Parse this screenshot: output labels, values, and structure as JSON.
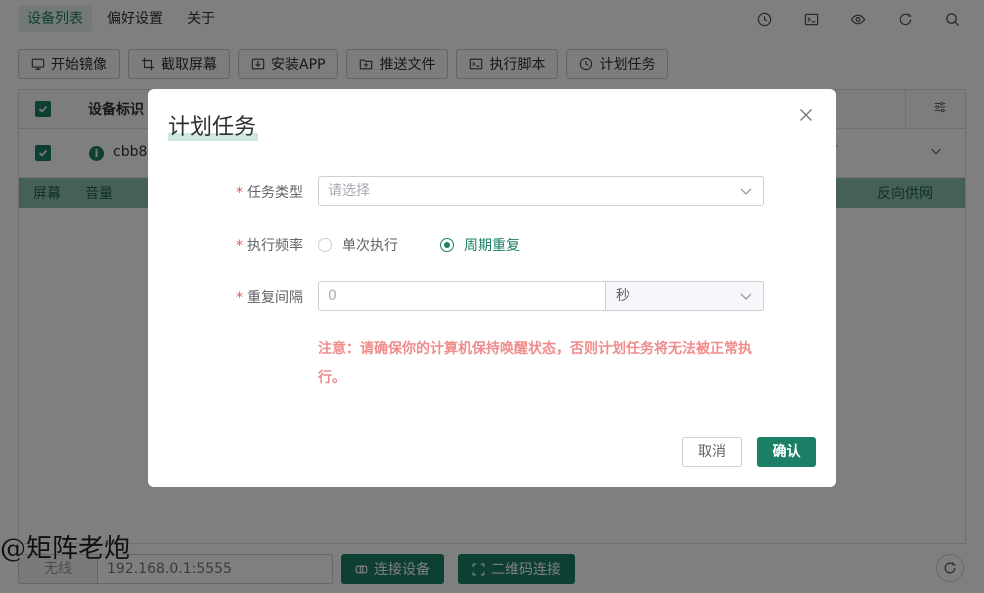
{
  "topnav": {
    "items": [
      {
        "label": "设备列表",
        "active": true
      },
      {
        "label": "偏好设置",
        "active": false
      },
      {
        "label": "关于",
        "active": false
      }
    ]
  },
  "topIcons": [
    "history-icon",
    "terminal-icon",
    "eye-icon",
    "refresh-icon",
    "search-icon"
  ],
  "toolbar": {
    "buttons": [
      {
        "label": "开始镜像",
        "icon": "monitor-icon"
      },
      {
        "label": "截取屏幕",
        "icon": "crop-icon"
      },
      {
        "label": "安装APP",
        "icon": "install-icon"
      },
      {
        "label": "推送文件",
        "icon": "folder-upload-icon"
      },
      {
        "label": "执行脚本",
        "icon": "terminal-icon"
      },
      {
        "label": "计划任务",
        "icon": "clock-icon"
      }
    ]
  },
  "table": {
    "header_label": "设备标识",
    "row_id": "cbb8",
    "greenbar_left": [
      "屏幕",
      "音量"
    ],
    "greenbar_right": "反向供网"
  },
  "footer": {
    "wire_label": "无线",
    "ip_value": "192.168.0.1:5555",
    "connect_label": "连接设备",
    "qr_label": "二维码连接"
  },
  "watermark": "@矩阵老炮",
  "dialog": {
    "title": "计划任务",
    "task_type_label": "任务类型",
    "task_type_placeholder": "请选择",
    "frequency_label": "执行频率",
    "frequency_options": [
      {
        "label": "单次执行",
        "checked": false
      },
      {
        "label": "周期重复",
        "checked": true
      }
    ],
    "interval_label": "重复间隔",
    "interval_value": "0",
    "interval_unit": "秒",
    "notice": "注意：请确保你的计算机保持唤醒状态，否则计划任务将无法被正常执行。",
    "cancel_label": "取消",
    "confirm_label": "确认"
  },
  "colors": {
    "accent": "#1a7f64",
    "notice": "#f08c8c",
    "required": "#e8544d"
  }
}
